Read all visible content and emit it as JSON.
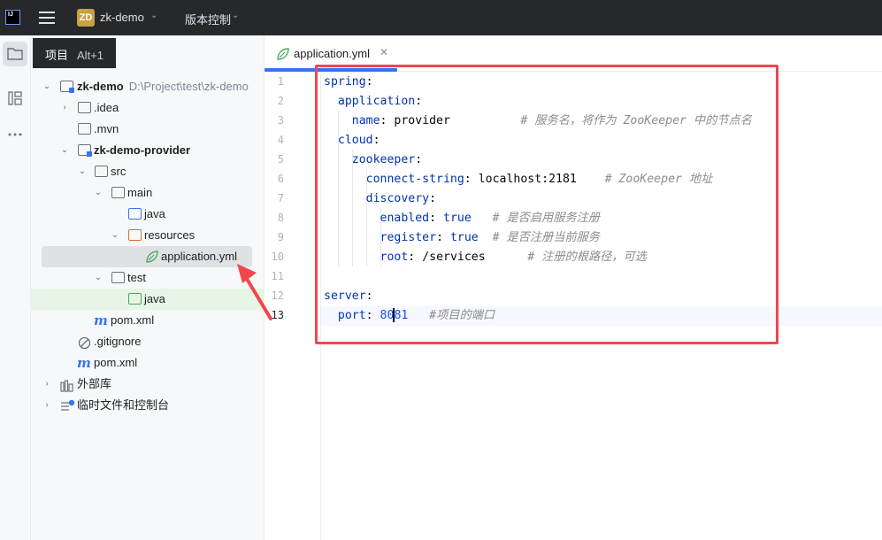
{
  "titlebar": {
    "app_logo_text": "IJ",
    "project_badge": "ZD",
    "project_name": "zk-demo",
    "vcs_menu": "版本控制"
  },
  "project_panel": {
    "tab_label": "项目",
    "tab_shortcut": "Alt+1",
    "tree": [
      {
        "label": "zk-demo",
        "path": "D:\\Project\\test\\zk-demo"
      },
      {
        "label": ".idea"
      },
      {
        "label": ".mvn"
      },
      {
        "label": "zk-demo-provider"
      },
      {
        "label": "src"
      },
      {
        "label": "main"
      },
      {
        "label": "java"
      },
      {
        "label": "resources"
      },
      {
        "label": "application.yml"
      },
      {
        "label": "test"
      },
      {
        "label": "java"
      },
      {
        "label": "pom.xml"
      },
      {
        "label": ".gitignore"
      },
      {
        "label": "pom.xml"
      },
      {
        "label": "外部库"
      },
      {
        "label": "临时文件和控制台"
      }
    ]
  },
  "editor": {
    "tab_name": "application.yml",
    "line_numbers": [
      "1",
      "2",
      "3",
      "4",
      "5",
      "6",
      "7",
      "8",
      "9",
      "10",
      "11",
      "12",
      "13"
    ],
    "code": {
      "l1_key": "spring",
      "l2_key": "application",
      "l3_key": "name",
      "l3_val": "provider",
      "l3_comment": "# 服务名，将作为 ZooKeeper 中的节点名",
      "l4_key": "cloud",
      "l5_key": "zookeeper",
      "l6_key": "connect-string",
      "l6_val": "localhost:2181",
      "l6_comment": "# ZooKeeper 地址",
      "l7_key": "discovery",
      "l8_key": "enabled",
      "l8_val": "true",
      "l8_comment": "# 是否启用服务注册",
      "l9_key": "register",
      "l9_val": "true",
      "l9_comment": "# 是否注册当前服务",
      "l10_key": "root",
      "l10_val": "/services",
      "l10_comment": "# 注册的根路径，可选",
      "l12_key": "server",
      "l13_key": "port",
      "l13_val_a": "80",
      "l13_val_b": "81",
      "l13_comment": "#项目的端口"
    }
  },
  "colors": {
    "annotation_red": "#f0474d",
    "accent_blue": "#3574f0",
    "yaml_key": "#0033b3",
    "yaml_number": "#1750eb",
    "comment": "#8c8c8c"
  }
}
